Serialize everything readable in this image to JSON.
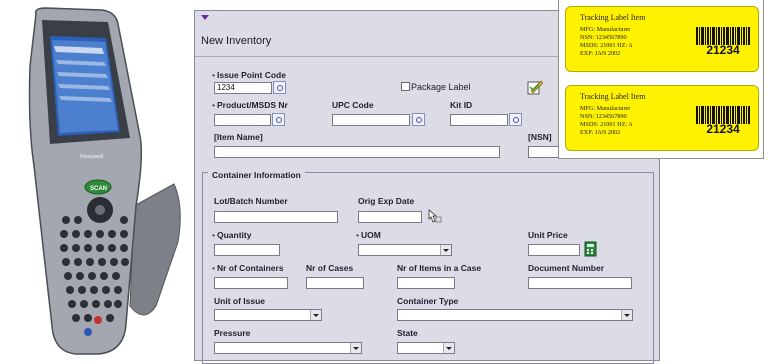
{
  "form": {
    "title": "New Inventory",
    "fields": {
      "issue_point_code": {
        "label": "Issue Point Code",
        "value": "1234"
      },
      "package_label": {
        "label": "Package Label"
      },
      "product_msds_nr": {
        "label": "Product/MSDS Nr"
      },
      "upc_code": {
        "label": "UPC Code"
      },
      "kit_id": {
        "label": "Kit ID"
      },
      "item_name": {
        "label": "[Item Name]"
      },
      "nsn": {
        "label": "[NSN]"
      }
    },
    "container": {
      "legend": "Container Information",
      "lot_batch_number": {
        "label": "Lot/Batch Number"
      },
      "orig_exp_date": {
        "label": "Orig Exp Date"
      },
      "quantity": {
        "label": "Quantity"
      },
      "uom": {
        "label": "UOM"
      },
      "unit_price": {
        "label": "Unit Price"
      },
      "nr_of_containers": {
        "label": "Nr of Containers"
      },
      "nr_of_cases": {
        "label": "Nr of Cases"
      },
      "nr_items_in_case": {
        "label": "Nr of Items in a Case"
      },
      "document_number": {
        "label": "Document Number"
      },
      "unit_of_issue": {
        "label": "Unit of Issue"
      },
      "container_type": {
        "label": "Container Type"
      },
      "pressure": {
        "label": "Pressure"
      },
      "state": {
        "label": "State"
      }
    }
  },
  "labels": [
    {
      "title": "Tracking Label Item",
      "lines": [
        "MFG: Manufacturer",
        "NSN: 1234567890",
        "MSDS: 21001   HZ: A",
        "EXP: JAN 2002"
      ],
      "barcode_number": "21234"
    },
    {
      "title": "Tracking Label Item",
      "lines": [
        "MFG: Manufacturer",
        "NSN: 1234567890",
        "MSDS: 21001   HZ: A",
        "EXP: JAN 2002"
      ],
      "barcode_number": "21234"
    }
  ],
  "device": {
    "brand": "Honeywell",
    "scan_key": "SCAN"
  },
  "colors": {
    "label_yellow": "#fff200",
    "window_bg": "#dcdce6",
    "device_body": "#9aa0a8"
  }
}
